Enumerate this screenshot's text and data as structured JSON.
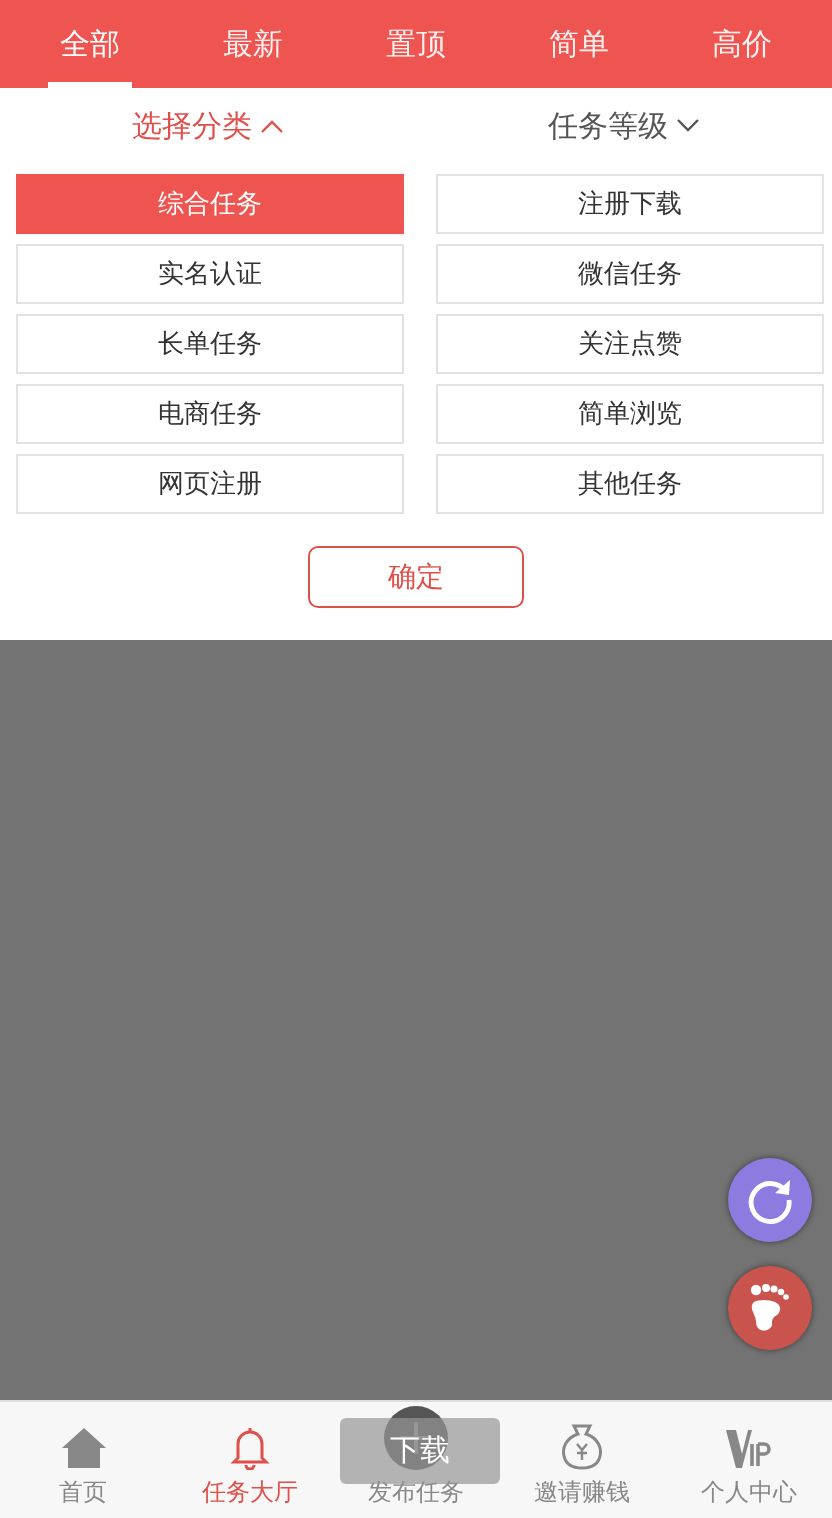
{
  "tabs": [
    {
      "label": "全部",
      "selected": true
    },
    {
      "label": "最新",
      "selected": false
    },
    {
      "label": "置顶",
      "selected": false
    },
    {
      "label": "简单",
      "selected": false
    },
    {
      "label": "高价",
      "selected": false
    }
  ],
  "filters": [
    {
      "label": "选择分类",
      "expanded": true
    },
    {
      "label": "任务等级",
      "expanded": false
    }
  ],
  "categories": [
    {
      "label": "综合任务",
      "selected": true
    },
    {
      "label": "注册下载",
      "selected": false
    },
    {
      "label": "实名认证",
      "selected": false
    },
    {
      "label": "微信任务",
      "selected": false
    },
    {
      "label": "长单任务",
      "selected": false
    },
    {
      "label": "关注点赞",
      "selected": false
    },
    {
      "label": "电商任务",
      "selected": false
    },
    {
      "label": "简单浏览",
      "selected": false
    },
    {
      "label": "网页注册",
      "selected": false
    },
    {
      "label": "其他任务",
      "selected": false
    }
  ],
  "confirm_button": "确定",
  "bottom_nav": [
    {
      "label": "首页",
      "kind": "home",
      "selected": false
    },
    {
      "label": "任务大厅",
      "kind": "bell",
      "selected": true
    },
    {
      "label": "发布任务",
      "kind": "plus",
      "selected": false
    },
    {
      "label": "邀请赚钱",
      "kind": "moneybag",
      "selected": false
    },
    {
      "label": "个人中心",
      "kind": "vip",
      "selected": false
    }
  ],
  "toast": "下载"
}
